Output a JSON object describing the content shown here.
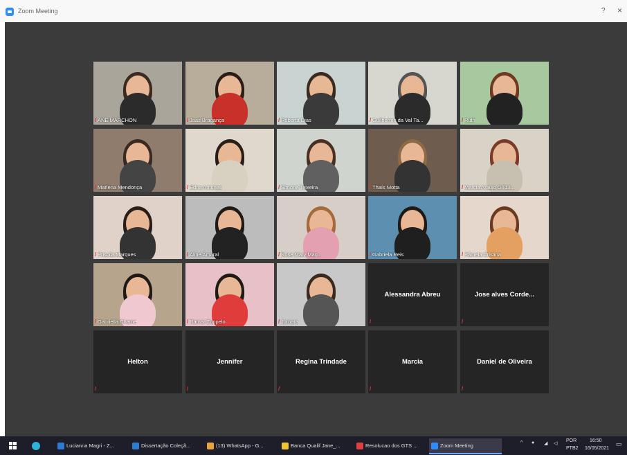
{
  "window": {
    "title": "Zoom Meeting",
    "help_glyph": "?",
    "close_glyph": "×"
  },
  "participants": [
    {
      "name": "ANE MARCHON",
      "video": true,
      "bg": "#a9a59a",
      "hair": "#3a2a20",
      "shirt": "#2b2b2b"
    },
    {
      "name": "Jaas Bragança",
      "video": true,
      "bg": "#b8ad9a",
      "hair": "#2a1c16",
      "shirt": "#c8302a"
    },
    {
      "name": "Roberta Dias",
      "video": true,
      "bg": "#c9d3d2",
      "hair": "#3b2a20",
      "shirt": "#3a3a3a"
    },
    {
      "name": "Guilherme da Val Ta...",
      "video": true,
      "bg": "#d8d7cf",
      "hair": "#555",
      "shirt": "#2b2b2b",
      "active": true
    },
    {
      "name": "Ruth",
      "video": true,
      "bg": "#a8c9a0",
      "hair": "#6e3a22",
      "shirt": "#222"
    },
    {
      "name": "Marlena Mendonça",
      "video": true,
      "bg": "#8f7c6c",
      "hair": "#3a2a22",
      "shirt": "#444"
    },
    {
      "name": "Edna Antunes",
      "video": true,
      "bg": "#e0d8cc",
      "hair": "#2a1f18",
      "shirt": "#d8d0c0"
    },
    {
      "name": "Simone Teixeira",
      "video": true,
      "bg": "#cfd4cf",
      "hair": "#4a3024",
      "shirt": "#606060"
    },
    {
      "name": "Thaís Motta",
      "video": true,
      "bg": "#6e5c4e",
      "hair": "#8b6a44",
      "shirt": "#333"
    },
    {
      "name": "Marcia Araujo GT13...",
      "video": true,
      "bg": "#d9d2c7",
      "hair": "#7a3c28",
      "shirt": "#c7c0b0"
    },
    {
      "name": "Priscila Marques",
      "video": true,
      "bg": "#e0d2c8",
      "hair": "#2a1f18",
      "shirt": "#333"
    },
    {
      "name": "Aline Amaral",
      "video": true,
      "bg": "#bcbcbc",
      "hair": "#1f1a16",
      "shirt": "#222"
    },
    {
      "name": "Rose Mary Mag...",
      "video": true,
      "bg": "#d7cfc7",
      "hair": "#a46a3a",
      "shirt": "#e2a0b0"
    },
    {
      "name": "Gabriela Reis",
      "video": true,
      "bg": "#5c8fb0",
      "hair": "#1f1a16",
      "shirt": "#1f1f1f"
    },
    {
      "name": "Pâmela Cristina",
      "video": true,
      "bg": "#e6d7cc",
      "hair": "#6b3a20",
      "shirt": "#e4a060"
    },
    {
      "name": "Gabriella Chame",
      "video": true,
      "bg": "#b6a48c",
      "hair": "#1f1a16",
      "shirt": "#f0c8d0"
    },
    {
      "name": "Ramar Zuppelo",
      "video": true,
      "bg": "#e8c0c8",
      "hair": "#1f1a16",
      "shirt": "#e03c3c"
    },
    {
      "name": "Jumara",
      "video": true,
      "bg": "#c8c8c8",
      "hair": "#3a2a20",
      "shirt": "#555"
    },
    {
      "name": "Alessandra Abreu",
      "video": false
    },
    {
      "name": "Jose alves Corde...",
      "video": false
    },
    {
      "name": "Helton",
      "video": false
    },
    {
      "name": "Jennifer",
      "video": false
    },
    {
      "name": "Regina Trindade",
      "video": false
    },
    {
      "name": "Marcia",
      "video": false
    },
    {
      "name": "Daniel de Oliveira",
      "video": false
    }
  ],
  "taskbar": {
    "apps": [
      {
        "label": "Lucianna Magri - Z...",
        "color": "#2b7cd3"
      },
      {
        "label": "Dissertação Coleçã...",
        "color": "#2b7cd3"
      },
      {
        "label": "(13) WhatsApp - G...",
        "color": "#e8a33c"
      },
      {
        "label": "Banca Qualif Jane_...",
        "color": "#f2c230"
      },
      {
        "label": "Resolucao dos GTS ...",
        "color": "#e04040"
      },
      {
        "label": "Zoom Meeting",
        "color": "#2d8cff",
        "active": true
      }
    ],
    "lang": "POR",
    "lang2": "PTB2",
    "time": "16:50",
    "date": "16/05/2021"
  },
  "colors": {
    "meeting_bg": "#3b3b3b",
    "tile_bg": "#252525",
    "active_border": "#d6d43a",
    "muted_mic": "#e03030"
  }
}
